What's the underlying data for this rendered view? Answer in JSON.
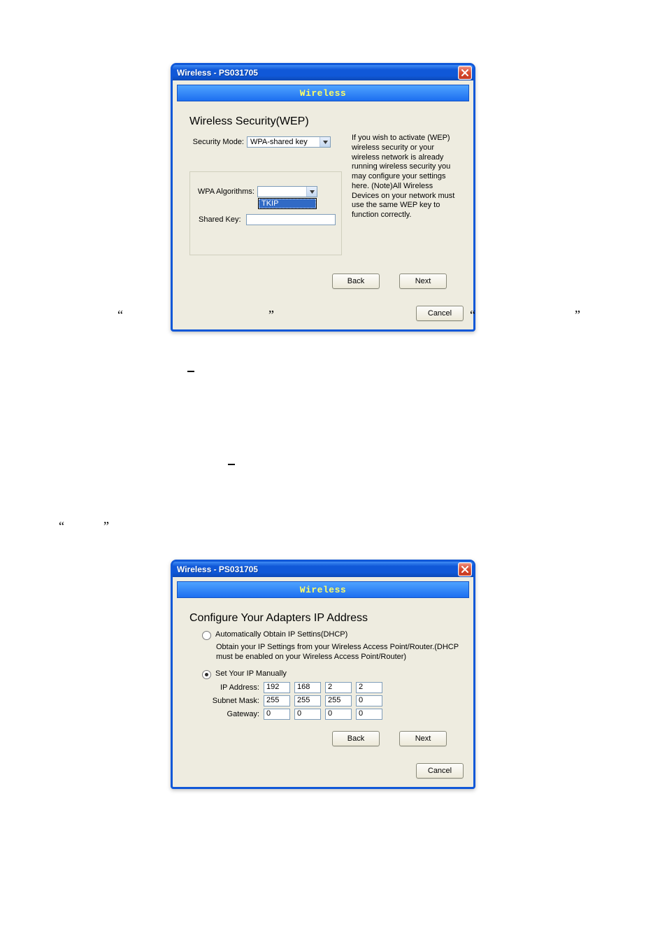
{
  "dialog1": {
    "title": "Wireless - PS031705",
    "banner": "Wireless",
    "heading": "Wireless Security(WEP)",
    "security_mode_label": "Security Mode:",
    "security_mode_value": "WPA-shared key",
    "wpa_algorithms_label": "WPA Algorithms:",
    "wpa_dropdown_highlight": "TKIP",
    "shared_key_label": "Shared Key:",
    "info_text": "If you wish to activate (WEP) wireless security or your wireless network is already running wireless security you may configure your settings here. (Note)All Wireless Devices on your network must use the same WEP key to function correctly.",
    "back": "Back",
    "next": "Next",
    "cancel": "Cancel"
  },
  "dialog2": {
    "title": "Wireless - PS031705",
    "banner": "Wireless",
    "heading": "Configure Your Adapters IP Address",
    "radio_dhcp_label": "Automatically Obtain IP Settins(DHCP)",
    "dhcp_desc": "Obtain your IP Settings from your Wireless Access Point/Router.(DHCP must be enabled on your Wireless Access Point/Router)",
    "radio_manual_label": "Set Your IP Manually",
    "ip_address_label": "IP Address:",
    "ip": [
      "192",
      "168",
      "2",
      "2"
    ],
    "subnet_label": "Subnet Mask:",
    "subnet": [
      "255",
      "255",
      "255",
      "0"
    ],
    "gateway_label": "Gateway:",
    "gateway": [
      "0",
      "0",
      "0",
      "0"
    ],
    "back": "Back",
    "next": "Next",
    "cancel": "Cancel"
  },
  "quotes": {
    "open": "“",
    "close": "”"
  }
}
